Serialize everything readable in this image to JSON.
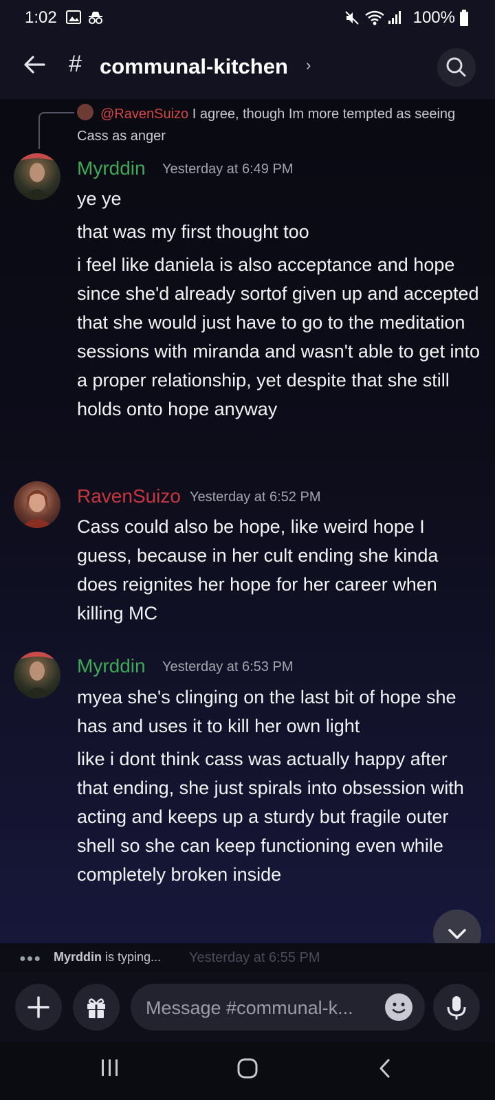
{
  "status_bar": {
    "time": "1:02",
    "battery": "100%"
  },
  "header": {
    "channel_name": "communal-kitchen"
  },
  "reply_preview": {
    "mention": "@RavenSuizo",
    "text": "I agree, though Im more tempted as seeing Cass as anger"
  },
  "messages": [
    {
      "author": "Myrddin",
      "timestamp": "Yesterday at 6:49 PM",
      "lines": [
        "ye ye",
        "that was my first thought too",
        "i feel like daniela is also acceptance and hope since she'd already sortof given up and accepted that she would just have to go to the meditation sessions with miranda and wasn't able to get into a proper relationship, yet despite that she still holds onto hope anyway"
      ]
    },
    {
      "author": "RavenSuizo",
      "timestamp": "Yesterday at 6:52 PM",
      "lines": [
        "Cass could also be hope, like weird hope I guess, because in her cult ending she kinda does reignites her hope for her career when killing MC"
      ]
    },
    {
      "author": "Myrddin",
      "timestamp": "Yesterday at 6:53 PM",
      "lines": [
        "myea she's clinging on the last bit of hope she has and uses it to kill her own light",
        "like i dont think cass was actually happy after that ending, she just spirals into obsession with acting and keeps up a sturdy but fragile outer shell so she can keep functioning even  while completely broken inside"
      ]
    }
  ],
  "typing_indicator": {
    "user": "Myrddin",
    "text": "is typing...",
    "ghost_timestamp": "Yesterday at 6:55 PM"
  },
  "composer": {
    "placeholder": "Message #communal-k..."
  },
  "colors": {
    "myrddin_name": "#3fa957",
    "raven_name": "#c6373d"
  }
}
